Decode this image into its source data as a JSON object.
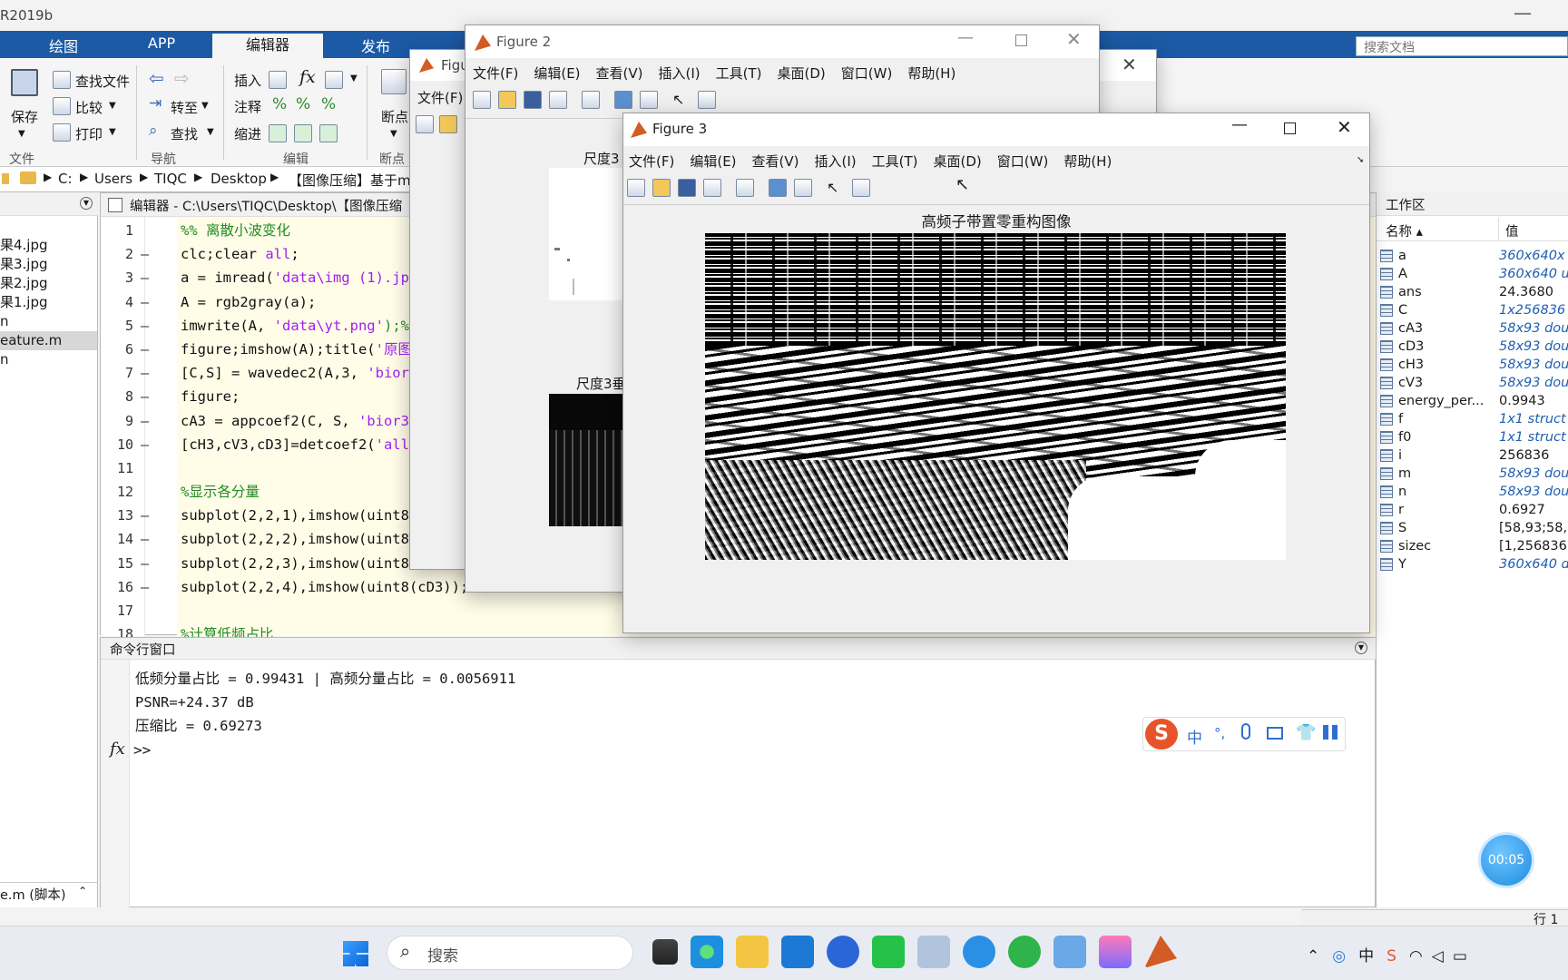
{
  "app": {
    "title": "R2019b"
  },
  "ribbon": {
    "tabs": [
      "绘图",
      "APP",
      "编辑器",
      "发布"
    ],
    "file_group": {
      "save": "保存",
      "find_files": "查找文件",
      "compare": "比较",
      "print": "打印",
      "label": "文件"
    },
    "nav_group": {
      "goto": "转至",
      "find": "查找",
      "label": "导航"
    },
    "edit_group": {
      "insert": "插入",
      "comment": "注释",
      "indent": "缩进",
      "label": "编辑"
    },
    "breakpoint_group": {
      "breakpoints": "断点",
      "label": "断点"
    },
    "search_placeholder": "搜索文档"
  },
  "path": {
    "segments": [
      "C:",
      "Users",
      "TIQC",
      "Desktop",
      "【图像压缩】基于m"
    ]
  },
  "files": {
    "items": [
      "果4.jpg",
      "果3.jpg",
      "果2.jpg",
      "果1.jpg",
      "n",
      "eature.m",
      "n"
    ],
    "footer": "e.m (脚本)"
  },
  "editor": {
    "title": "编辑器 - C:\\Users\\TIQC\\Desktop\\【图像压缩",
    "lines": [
      {
        "n": "1",
        "dash": "",
        "parts": [
          [
            "%% 离散小波变化",
            "green"
          ]
        ]
      },
      {
        "n": "2",
        "dash": "—",
        "parts": [
          [
            "clc;clear ",
            ""
          ],
          [
            "all",
            "purple"
          ],
          [
            ";",
            ""
          ]
        ]
      },
      {
        "n": "3",
        "dash": "—",
        "parts": [
          [
            "a = imread(",
            ""
          ],
          [
            "'data\\img (1).jpg'",
            "purple"
          ]
        ]
      },
      {
        "n": "4",
        "dash": "—",
        "parts": [
          [
            "A = rgb2gray(a);",
            ""
          ]
        ]
      },
      {
        "n": "5",
        "dash": "—",
        "parts": [
          [
            "imwrite(A, ",
            ""
          ],
          [
            "'data\\yt.png'",
            "purple"
          ],
          [
            ");%保",
            "green"
          ]
        ]
      },
      {
        "n": "6",
        "dash": "—",
        "parts": [
          [
            "figure;imshow(A);title(",
            ""
          ],
          [
            "'原图'",
            "purple"
          ]
        ]
      },
      {
        "n": "7",
        "dash": "—",
        "parts": [
          [
            "[C,S] = wavedec2(A,3, ",
            ""
          ],
          [
            "'bior3.",
            "purple"
          ]
        ]
      },
      {
        "n": "8",
        "dash": "—",
        "parts": [
          [
            "figure;",
            ""
          ]
        ]
      },
      {
        "n": "9",
        "dash": "—",
        "parts": [
          [
            "cA3 = appcoef2(C, S, ",
            ""
          ],
          [
            "'bior3.7",
            "purple"
          ]
        ]
      },
      {
        "n": "10",
        "dash": "—",
        "parts": [
          [
            "[cH3,cV3,cD3]=detcoef2(",
            ""
          ],
          [
            "'all'",
            "purple"
          ],
          [
            ",",
            ""
          ]
        ]
      },
      {
        "n": "11",
        "dash": "",
        "parts": [
          [
            "",
            ""
          ]
        ]
      },
      {
        "n": "12",
        "dash": "",
        "parts": [
          [
            "%显示各分量",
            "green"
          ]
        ]
      },
      {
        "n": "13",
        "dash": "—",
        "parts": [
          [
            "subplot(2,2,1),imshow(uint8(c",
            ""
          ]
        ]
      },
      {
        "n": "14",
        "dash": "—",
        "parts": [
          [
            "subplot(2,2,2),imshow(uint8(c",
            ""
          ]
        ]
      },
      {
        "n": "15",
        "dash": "—",
        "parts": [
          [
            "subplot(2,2,3),imshow(uint8(c",
            ""
          ]
        ]
      },
      {
        "n": "16",
        "dash": "—",
        "parts": [
          [
            "subplot(2,2,4),imshow(uint8(cD3));a",
            ""
          ]
        ]
      },
      {
        "n": "17",
        "dash": "",
        "parts": [
          [
            "",
            ""
          ]
        ]
      },
      {
        "n": "18",
        "dash": "",
        "parts": [
          [
            "%计算低频占比",
            "green"
          ]
        ]
      }
    ]
  },
  "command": {
    "title": "命令行窗口",
    "lines": [
      "低频分量占比 = 0.99431 | 高频分量占比 = 0.0056911",
      "PSNR=+24.37 dB",
      "压缩比 = 0.69273"
    ],
    "prompt": ">>"
  },
  "workspace": {
    "title": "工作区",
    "col_name": "名称 ▴",
    "col_value": "值",
    "rows": [
      {
        "name": "a",
        "value": "360x640x",
        "italic": true
      },
      {
        "name": "A",
        "value": "360x640 u",
        "italic": true
      },
      {
        "name": "ans",
        "value": "24.3680",
        "italic": false
      },
      {
        "name": "C",
        "value": "1x256836",
        "italic": true
      },
      {
        "name": "cA3",
        "value": "58x93 dou",
        "italic": true
      },
      {
        "name": "cD3",
        "value": "58x93 dou",
        "italic": true
      },
      {
        "name": "cH3",
        "value": "58x93 dou",
        "italic": true
      },
      {
        "name": "cV3",
        "value": "58x93 dou",
        "italic": true
      },
      {
        "name": "energy_per...",
        "value": "0.9943",
        "italic": false
      },
      {
        "name": "f",
        "value": "1x1 struct",
        "italic": true
      },
      {
        "name": "f0",
        "value": "1x1 struct",
        "italic": true
      },
      {
        "name": "i",
        "value": "256836",
        "italic": false
      },
      {
        "name": "m",
        "value": "58x93 dou",
        "italic": true
      },
      {
        "name": "n",
        "value": "58x93 dou",
        "italic": true
      },
      {
        "name": "r",
        "value": "0.6927",
        "italic": false
      },
      {
        "name": "S",
        "value": "[58,93;58,9",
        "italic": false
      },
      {
        "name": "sizec",
        "value": "[1,256836",
        "italic": false
      },
      {
        "name": "Y",
        "value": "360x640 d",
        "italic": true
      }
    ]
  },
  "figure_back": {
    "title": "Figu",
    "menu": "文件(F)"
  },
  "figure2": {
    "title": "Figure 2",
    "menus": [
      "文件(F)",
      "编辑(E)",
      "查看(V)",
      "插入(I)",
      "工具(T)",
      "桌面(D)",
      "窗口(W)",
      "帮助(H)"
    ],
    "label_top": "尺度3",
    "label_bottom": "尺度3垂"
  },
  "figure3": {
    "title": "Figure 3",
    "menus": [
      "文件(F)",
      "编辑(E)",
      "查看(V)",
      "插入(I)",
      "工具(T)",
      "桌面(D)",
      "窗口(W)",
      "帮助(H)"
    ],
    "plot_title": "高频子带置零重构图像"
  },
  "ime": {
    "items": [
      "中",
      "°,"
    ]
  },
  "timer": {
    "value": "00:05"
  },
  "status": {
    "row_label": "行 1"
  },
  "taskbar": {
    "search_placeholder": "搜索"
  }
}
